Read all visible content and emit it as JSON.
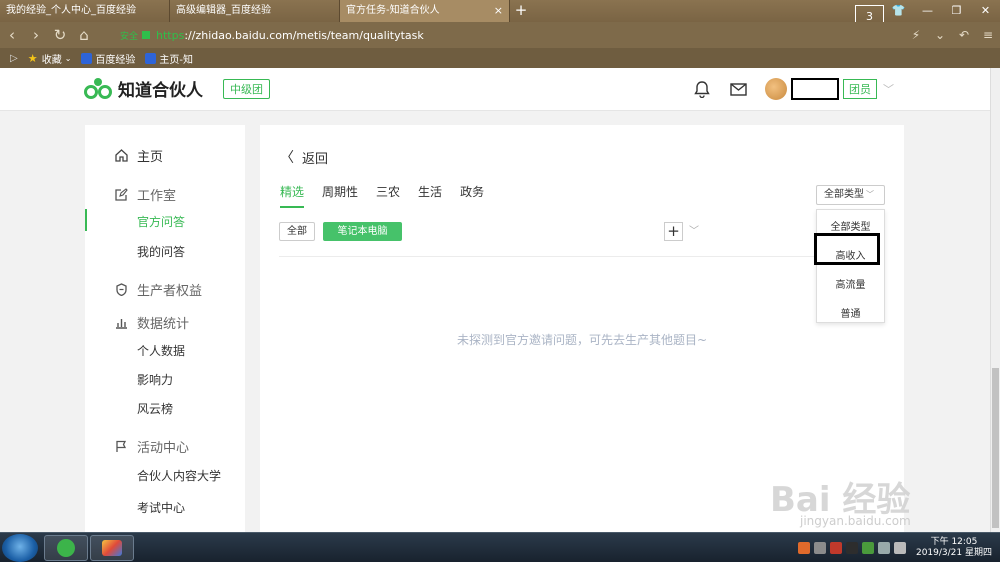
{
  "browser": {
    "tabs": [
      {
        "title": "我的经验_个人中心_百度经验",
        "active": false
      },
      {
        "title": "高级编辑器_百度经验",
        "active": false
      },
      {
        "title": "官方任务-知道合伙人",
        "active": true
      }
    ],
    "new_tab": "+",
    "tab_count": "3",
    "url_secure": "安全",
    "url_scheme": "https",
    "url_rest": "://zhidao.baidu.com/metis/team/qualitytask",
    "bookmarks": [
      {
        "label": "收藏",
        "icon": "star-icon"
      },
      {
        "label": "百度经验",
        "icon": "baidu-icon"
      },
      {
        "label": "主页-知",
        "icon": "baidu-icon"
      }
    ]
  },
  "header": {
    "logo_text": "知道合伙人",
    "level_badge": "中级团",
    "role_badge": "团员"
  },
  "sidebar": {
    "home": "主页",
    "studio": "工作室",
    "studio_items": [
      "官方问答",
      "我的问答"
    ],
    "rights": "生产者权益",
    "stats": "数据统计",
    "stats_items": [
      "个人数据",
      "影响力",
      "风云榜"
    ],
    "activity": "活动中心",
    "activity_items": [
      "合伙人内容大学",
      "考试中心"
    ]
  },
  "main": {
    "back_label": "返回",
    "tabs": [
      "精选",
      "周期性",
      "三农",
      "生活",
      "政务"
    ],
    "active_tab": "精选",
    "chips": {
      "all": "全部",
      "selected": "笔记本电脑"
    },
    "plus": "+",
    "empty_text": "未探测到官方邀请问题，可先去生产其他题目~",
    "type_select": {
      "value": "全部类型",
      "options": [
        "全部类型",
        "高收入",
        "高流量",
        "普通"
      ],
      "highlighted": "高收入"
    }
  },
  "watermark": {
    "text": "Bai 经验",
    "sub": "jingyan.baidu.com"
  },
  "taskbar": {
    "time": "下午 12:05",
    "date": "2019/3/21 星期四"
  },
  "colors": {
    "accent": "#38b954",
    "chrome": "#7e6a4a"
  }
}
